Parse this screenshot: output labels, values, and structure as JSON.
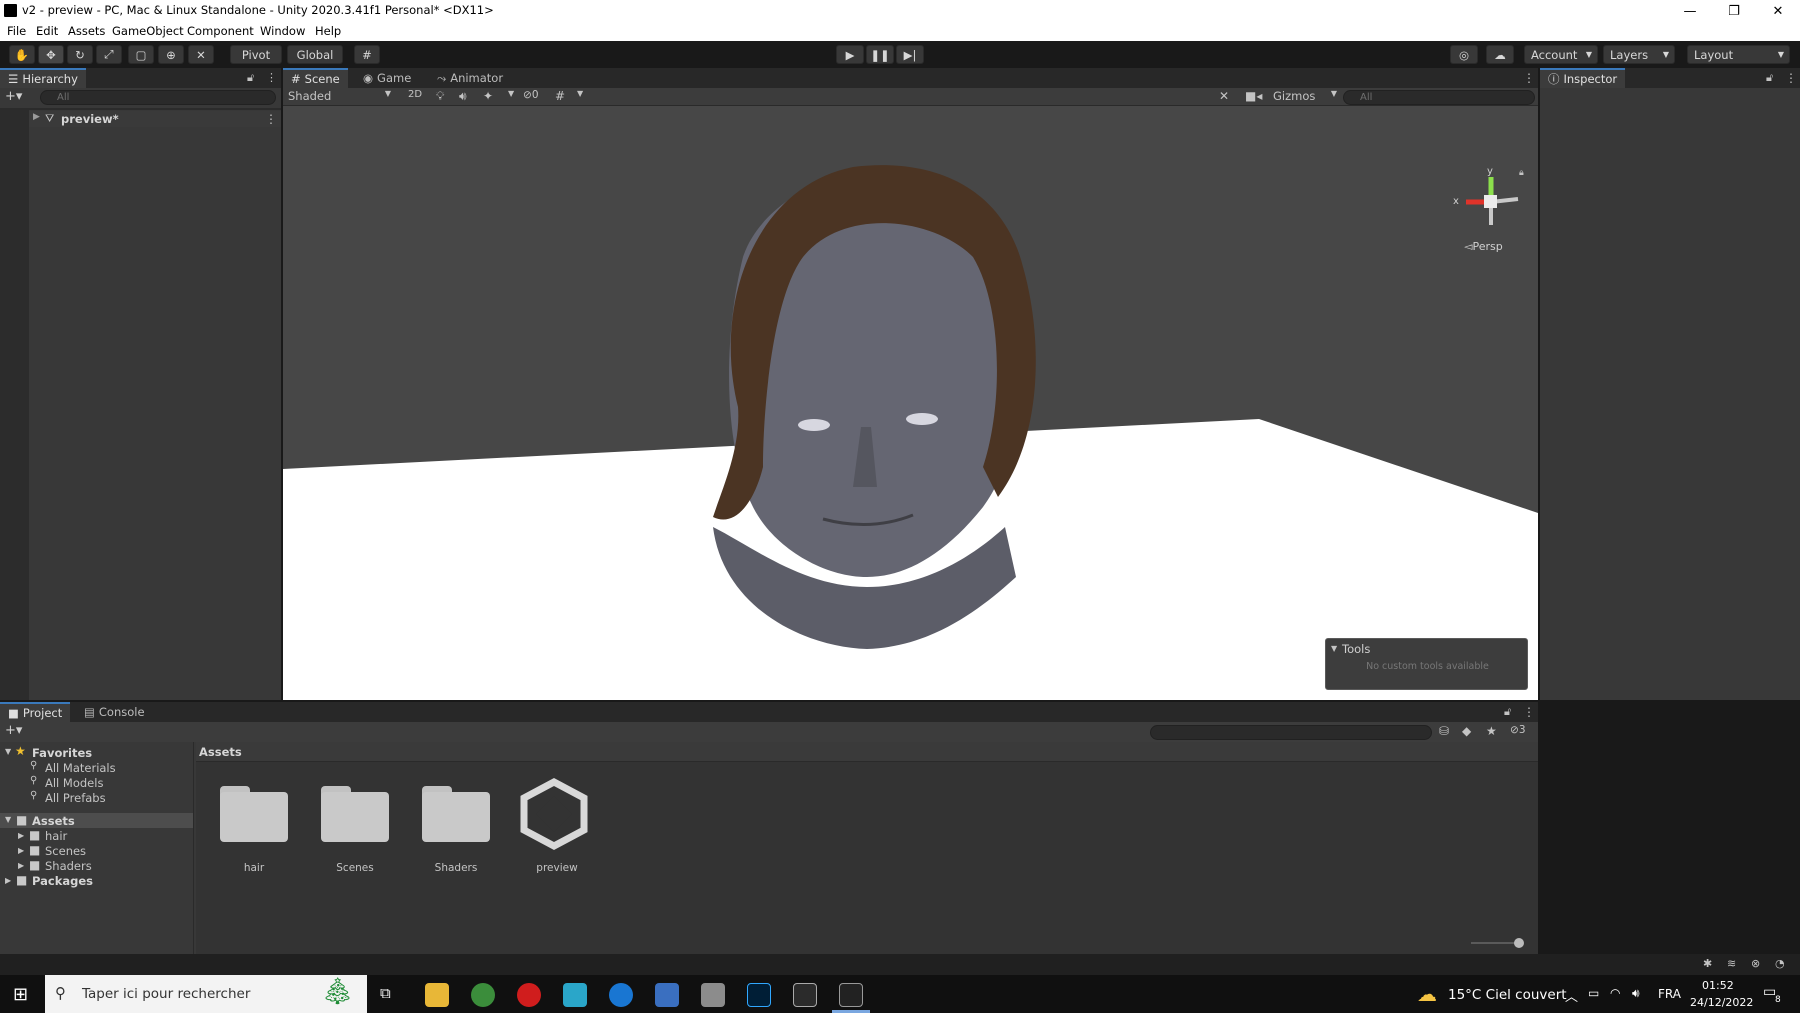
{
  "window": {
    "title": "v2 - preview - PC, Mac & Linux Standalone - Unity 2020.3.41f1 Personal* <DX11>",
    "minimize": "—",
    "maximize": "❐",
    "close": "✕"
  },
  "menu": [
    "File",
    "Edit",
    "Assets",
    "GameObject",
    "Component",
    "Window",
    "Help"
  ],
  "toolbar": {
    "pivot": "Pivot",
    "global": "Global",
    "account": "Account",
    "layers": "Layers",
    "layout": "Layout"
  },
  "hierarchy": {
    "tab": "Hierarchy",
    "search_placeholder": "All",
    "root_item": "preview*"
  },
  "scene": {
    "tabs": [
      "Scene",
      "Game",
      "Animator"
    ],
    "shading_mode": "Shaded",
    "mode_2d": "2D",
    "hidden_count": "0",
    "gizmos": "Gizmos",
    "search_placeholder": "All",
    "projection": "Persp",
    "axis_y": "y",
    "axis_x": "x",
    "tools_overlay_title": "Tools",
    "tools_overlay_text": "No custom tools available"
  },
  "inspector": {
    "tab": "Inspector"
  },
  "project": {
    "tabs": [
      "Project",
      "Console"
    ],
    "hidden_count": "3",
    "favorites_label": "Favorites",
    "favorites": [
      "All Materials",
      "All Models",
      "All Prefabs"
    ],
    "assets_label": "Assets",
    "assets_children": [
      "hair",
      "Scenes",
      "Shaders"
    ],
    "packages_label": "Packages",
    "breadcrumb": "Assets",
    "items": [
      "hair",
      "Scenes",
      "Shaders",
      "preview"
    ]
  },
  "taskbar": {
    "search_placeholder": "Taper ici pour rechercher",
    "weather": "15°C  Ciel couvert",
    "language": "FRA",
    "time": "01:52",
    "date": "24/12/2022",
    "notifications": "8"
  }
}
